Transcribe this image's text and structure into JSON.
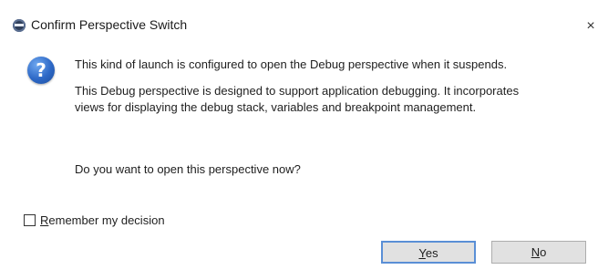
{
  "window": {
    "title": "Confirm Perspective Switch",
    "close_glyph": "×",
    "title_icon": "eclipse-logo-icon"
  },
  "message": {
    "icon": "question-icon",
    "icon_glyph": "?",
    "line1": "This kind of launch is configured to open the Debug perspective when it suspends.",
    "line2": "This Debug perspective is designed to support application debugging.  It incorporates views for displaying the debug stack, variables and breakpoint management.",
    "line3": "Do you want to open this perspective now?"
  },
  "remember": {
    "checked": false,
    "mnemonic": "R",
    "label_rest": "emember my decision"
  },
  "buttons": {
    "yes": {
      "mnemonic": "Y",
      "rest": "es"
    },
    "no": {
      "mnemonic": "N",
      "rest": "o"
    }
  },
  "colors": {
    "default_button_border": "#5a8fd6",
    "question_icon_blue": "#2d68c6"
  }
}
